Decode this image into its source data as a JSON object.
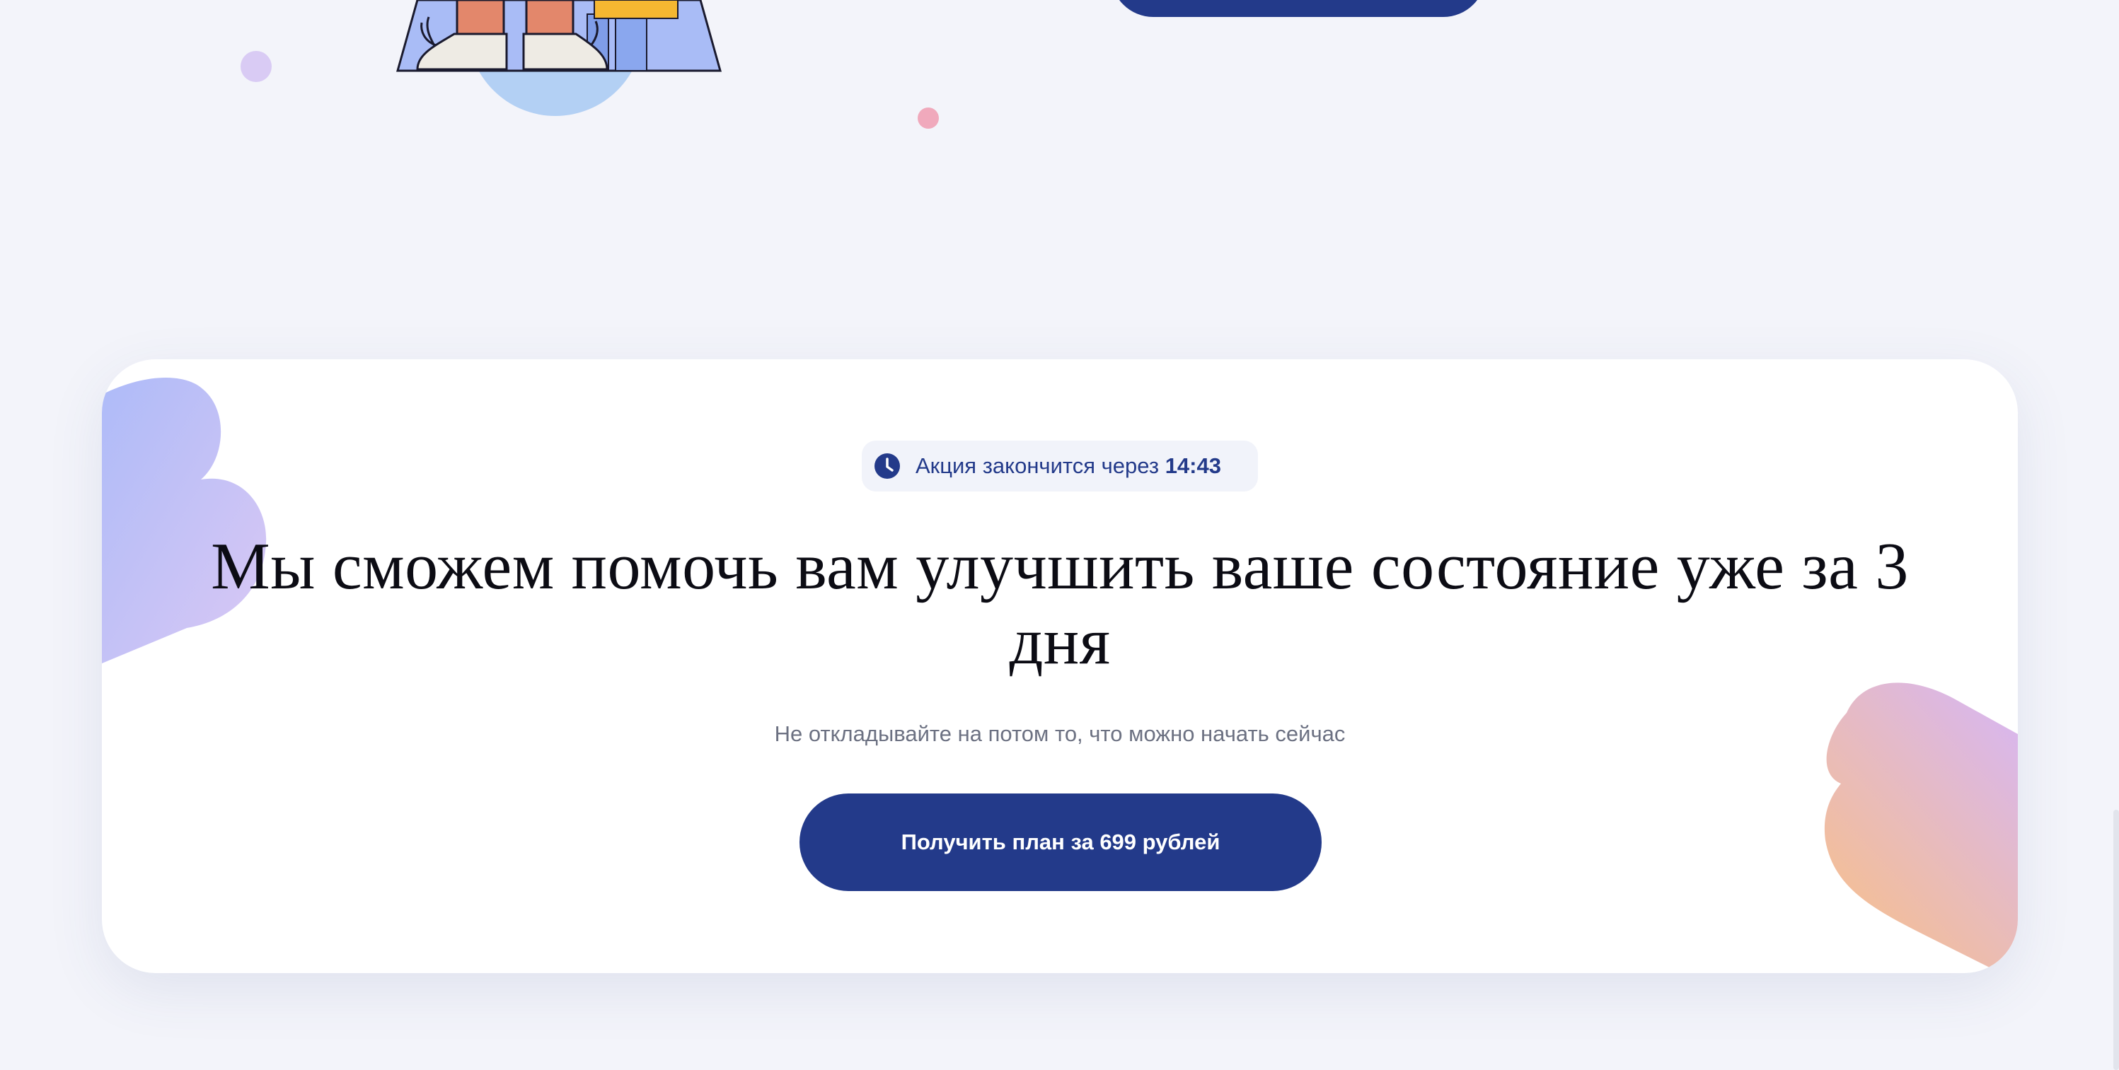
{
  "promo": {
    "timer_label": "Акция закончится через",
    "timer_value": "14:43",
    "headline": "Мы сможем помочь вам улучшить ваше состояние уже за 3 дня",
    "subtitle": "Не откладывайте на потом то, что можно начать сейчас",
    "cta_label": "Получить план за 699 рублей"
  },
  "icons": {
    "timer": "clock-icon"
  },
  "colors": {
    "page_background": "#f3f4fa",
    "card_background": "#ffffff",
    "accent": "#233a8a",
    "headline": "#0c0c14",
    "subtitle": "#6c7182",
    "timer_pill": "#f1f3fa"
  }
}
